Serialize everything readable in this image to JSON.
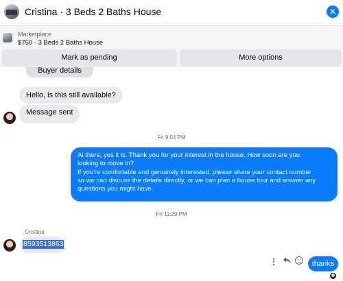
{
  "header": {
    "title": "Cristina · 3 Beds 2 Baths House",
    "close_icon": "close-icon"
  },
  "marketplace": {
    "label": "Marketplace",
    "listing": "$750 · 3 Beds 2 Baths House",
    "buttons": {
      "pending": "Mark as pending",
      "more": "More options"
    }
  },
  "messages": {
    "buyer_details": "Buyer details",
    "availability": "Hello, is this still available?",
    "message_sent": "Message sent",
    "timestamp1": "Fri 9:54 PM",
    "reply_line1": "Ai there, yes it is. Thank you for your interest in the house. How soon are you",
    "reply_line2": "looking to move in?",
    "reply_line3": "If you're comfortable and genuinely interested, please share your contact number",
    "reply_line4": "so we can discuss the details directly, or we can plan a house tour and answer any",
    "reply_line5": "questions you might have.",
    "timestamp2": "Fri 11:29 PM",
    "sender": "Cristina",
    "phone": "8593513863",
    "thanks": "thanks"
  },
  "colors": {
    "accent": "#0a7cff",
    "bubble_in": "#e9eaed",
    "selection": "#3b6fd6"
  },
  "icons": [
    "more-icon",
    "reply-icon",
    "react-icon"
  ]
}
